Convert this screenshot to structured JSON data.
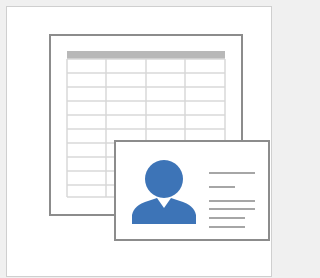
{
  "tile": {
    "icon": "contacts-template-icon",
    "components": [
      "datasheet-table-icon",
      "contact-card-icon"
    ]
  },
  "colors": {
    "page_background": "#f0f0f0",
    "tile_background": "#ffffff",
    "frame_border": "#8c8c8c",
    "grid_lines": "#d8d8d8",
    "grid_header": "#b8b8b8",
    "person": "#3d74b7",
    "text_lines": "#a6a6a6"
  }
}
